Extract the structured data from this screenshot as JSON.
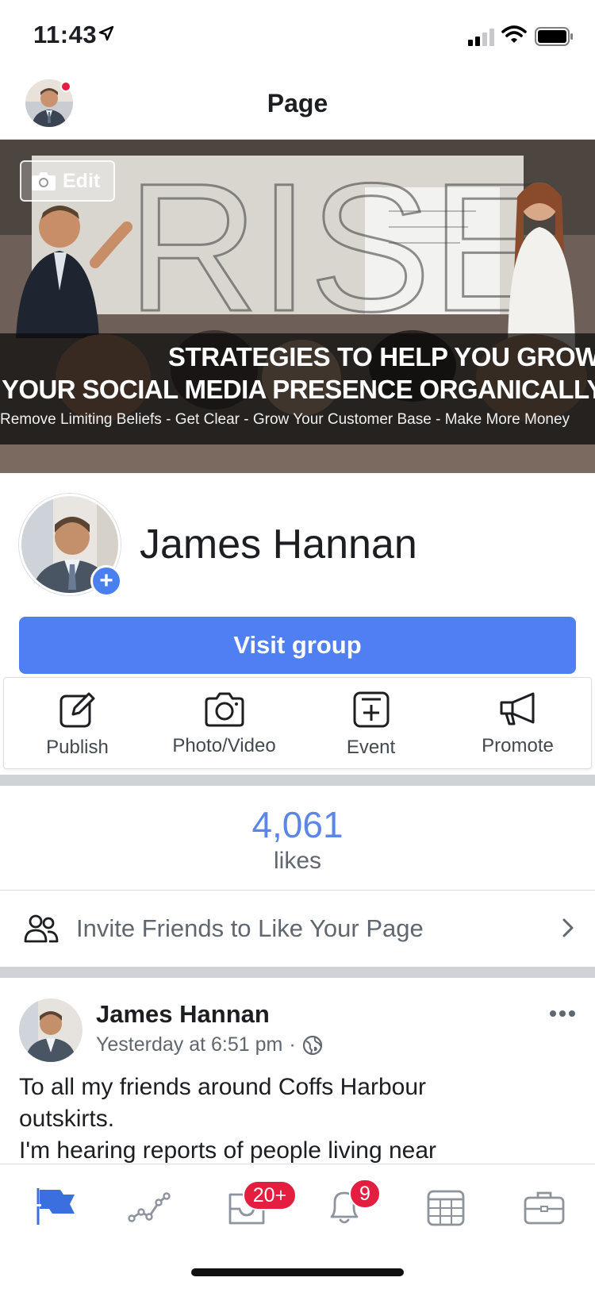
{
  "status_bar": {
    "time": "11:43"
  },
  "header": {
    "title": "Page"
  },
  "cover": {
    "edit_label": "Edit",
    "watermark": "RISE",
    "headline_1": "STRATEGIES TO HELP YOU GROW",
    "headline_2": "YOUR SOCIAL MEDIA PRESENCE ORGANICALLY",
    "tagline": "Remove Limiting Beliefs - Get Clear - Grow Your Customer Base - Make More Money"
  },
  "profile": {
    "name": "James Hannan",
    "add_symbol": "+"
  },
  "visit_button": {
    "label": "Visit group"
  },
  "actions": [
    {
      "label": "Publish",
      "icon": "edit-icon"
    },
    {
      "label": "Photo/Video",
      "icon": "camera-icon"
    },
    {
      "label": "Event",
      "icon": "event-plus-icon"
    },
    {
      "label": "Promote",
      "icon": "megaphone-icon"
    }
  ],
  "likes": {
    "count": "4,061",
    "label": "likes"
  },
  "invite": {
    "label": "Invite Friends to Like Your Page",
    "icon": "friends-icon"
  },
  "post": {
    "author": "James Hannan",
    "time": "Yesterday at 6:51 pm",
    "separator": "·",
    "text_lines": [
      "To all my friends around Coffs Harbour",
      "outskirts.",
      "I'm hearing reports of people living near"
    ]
  },
  "tabbar": {
    "items": [
      {
        "icon": "page-flag-icon",
        "active": true
      },
      {
        "icon": "insights-icon"
      },
      {
        "icon": "inbox-icon",
        "badge": "20+"
      },
      {
        "icon": "notifications-bell-icon",
        "badge": "9"
      },
      {
        "icon": "calendar-icon"
      },
      {
        "icon": "briefcase-icon"
      }
    ]
  },
  "colors": {
    "accent": "#4f7ff2",
    "likes": "#5b86e5",
    "badge": "#e41e3f",
    "active_tab": "#3b6fe0"
  }
}
